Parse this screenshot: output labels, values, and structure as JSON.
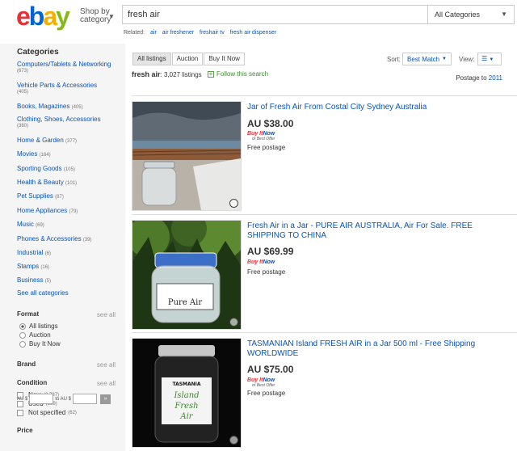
{
  "header": {
    "shop_by_line1": "Shop by",
    "shop_by_line2": "category",
    "search_value": "fresh air",
    "category_select": "All Categories",
    "related_label": "Related:",
    "related": [
      "air",
      "air freshener",
      "freshair tv",
      "fresh air dispenser"
    ]
  },
  "sidebar": {
    "categories_heading": "Categories",
    "categories": [
      {
        "label": "Computers/Tablets & Networking",
        "count": "(673)"
      },
      {
        "label": "Vehicle Parts & Accessories",
        "count": "(405)"
      },
      {
        "label": "Books, Magazines",
        "count": "(405)"
      },
      {
        "label": "Clothing, Shoes, Accessories",
        "count": "(360)"
      },
      {
        "label": "Home & Garden",
        "count": "(377)"
      },
      {
        "label": "Movies",
        "count": "(164)"
      },
      {
        "label": "Sporting Goods",
        "count": "(105)"
      },
      {
        "label": "Health & Beauty",
        "count": "(101)"
      },
      {
        "label": "Pet Supplies",
        "count": "(87)"
      },
      {
        "label": "Home Appliances",
        "count": "(79)"
      },
      {
        "label": "Music",
        "count": "(69)"
      },
      {
        "label": "Phones & Accessories",
        "count": "(39)"
      },
      {
        "label": "Industrial",
        "count": "(6)"
      },
      {
        "label": "Stamps",
        "count": "(16)"
      },
      {
        "label": "Business",
        "count": "(5)"
      }
    ],
    "see_all_categories": "See all categories",
    "format_heading": "Format",
    "see_all": "see all",
    "format_options": [
      "All listings",
      "Auction",
      "Buy It Now"
    ],
    "brand_heading": "Brand",
    "condition_heading": "Condition",
    "condition_options": [
      {
        "label": "New",
        "count": "(2,737)"
      },
      {
        "label": "Used",
        "count": "(239)"
      },
      {
        "label": "Not specified",
        "count": "(62)"
      }
    ],
    "price_heading": "Price",
    "price_from": "AU $",
    "price_to": "to AU $",
    "price_go": "»"
  },
  "main": {
    "tabs": [
      "All listings",
      "Auction",
      "Buy It Now"
    ],
    "sort_label": "Sort:",
    "sort_value": "Best Match",
    "view_label": "View:",
    "query": "fresh air",
    "count": ": 3,027 listings",
    "follow": "Follow this search",
    "postage_label": "Postage to",
    "postage_value": "2011",
    "buy_it": "Buy It",
    "now": "Now",
    "best_offer": "or Best Offer",
    "items": [
      {
        "title": "Jar of Fresh Air From Costal City Sydney Australia",
        "price": "AU $38.00",
        "best_offer": true,
        "shipping": "Free postage"
      },
      {
        "title": "Fresh Air in a Jar - PURE AIR AUSTRALIA, Air For Sale. FREE SHIPPING TO CHINA",
        "price": "AU $69.99",
        "best_offer": false,
        "shipping": "Free postage"
      },
      {
        "title": "TASMANIAN Island FRESH AIR in a Jar 500 ml - Free Shipping WORLDWIDE",
        "price": "AU $75.00",
        "best_offer": true,
        "shipping": "Free postage"
      }
    ],
    "jar_labels": {
      "pure_air": "Pure Air",
      "tasmania": "TASMANIA",
      "island": "Island",
      "fresh": "Fresh",
      "air": "Air"
    }
  },
  "colors": {
    "link": "#0654ba",
    "green": "#3d8c2e",
    "bin_red": "#e53238"
  }
}
